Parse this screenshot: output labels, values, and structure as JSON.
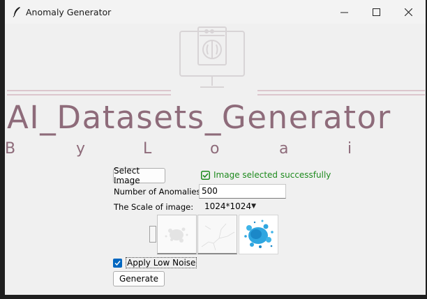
{
  "window": {
    "title": "Anomaly Generator",
    "minimize": "─",
    "maximize": "☐",
    "close": "✕"
  },
  "header": {
    "title": "AI_Datasets_Generator",
    "byline": [
      "B",
      "y",
      "L",
      "o",
      "a",
      "i"
    ],
    "accent_color": "#8e6b7a"
  },
  "controls": {
    "select_image_label": "Select Image",
    "status_text": "Image selected successfully",
    "anomalies_label": "Number of Anomalies:",
    "anomalies_value": "500",
    "scale_label": "The Scale of image:",
    "scale_value": "1024*1024",
    "apply_noise_label": "Apply Low Noise",
    "apply_noise_checked": true,
    "generate_label": "Generate"
  },
  "thumbnails": [
    {
      "name": "white-splash"
    },
    {
      "name": "gray-cracks"
    },
    {
      "name": "blue-splash"
    }
  ]
}
